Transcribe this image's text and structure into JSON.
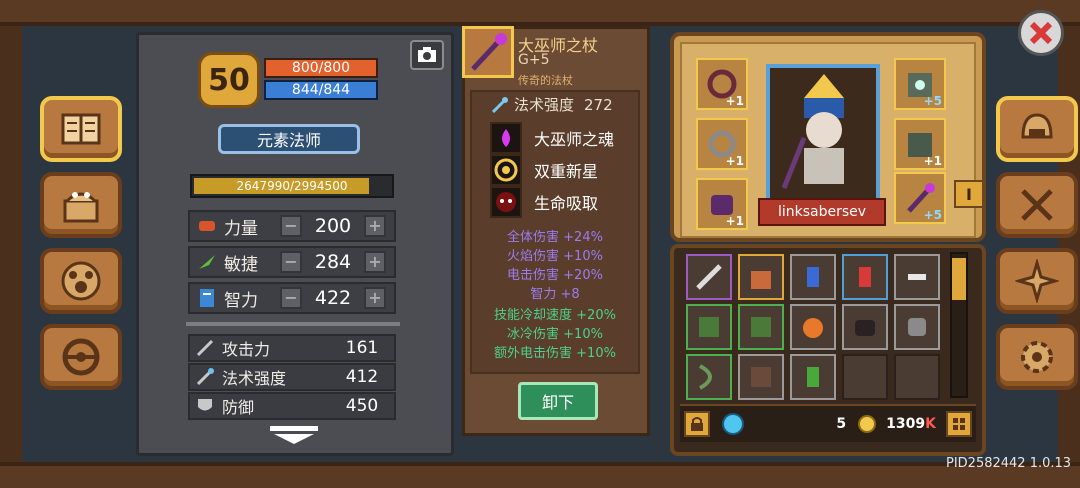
{
  "character": {
    "level": "50",
    "hp": "800/800",
    "mp": "844/844",
    "class_name": "元素法师",
    "xp_text": "2647990/2994500",
    "xp_fraction": 0.884,
    "attributes": [
      {
        "label": "力量",
        "value": "200",
        "color": "#d8542c"
      },
      {
        "label": "敏捷",
        "value": "284",
        "color": "#5fbf3a"
      },
      {
        "label": "智力",
        "value": "422",
        "color": "#3b88d6"
      }
    ],
    "stats": [
      {
        "label": "攻击力",
        "value": "161"
      },
      {
        "label": "法术强度",
        "value": "412"
      },
      {
        "label": "防御",
        "value": "450"
      }
    ]
  },
  "item": {
    "name": "大巫师之杖",
    "grade": "G+5",
    "type": "传奇的法杖",
    "magic_label": "法术强度",
    "magic_value": "272",
    "perks": [
      {
        "label": "大巫师之魂",
        "icon": "purple-flame-icon"
      },
      {
        "label": "双重新星",
        "icon": "target-icon"
      },
      {
        "label": "生命吸取",
        "icon": "skull-icon"
      }
    ],
    "bonuses": [
      {
        "text": "全体伤害 +24%",
        "color": "#9b7cf0"
      },
      {
        "text": "火焰伤害 +10%",
        "color": "#9b7cf0"
      },
      {
        "text": "电击伤害 +20%",
        "color": "#9b7cf0"
      },
      {
        "text": "智力 +8",
        "color": "#9b7cf0"
      },
      {
        "text": "技能冷却速度 +20%",
        "color": "#4fd08a"
      },
      {
        "text": "冰冷伤害 +10%",
        "color": "#4fd08a"
      },
      {
        "text": "额外电击伤害 +10%",
        "color": "#4fd08a"
      }
    ],
    "unequip_label": "卸下"
  },
  "equipment": {
    "player_name": "linksabersev",
    "tag_label": "I",
    "slots": [
      {
        "name": "necklace-slot",
        "plus": "+1"
      },
      {
        "name": "ring-slot",
        "plus": "+1"
      },
      {
        "name": "gloves-slot",
        "plus": "+1"
      },
      {
        "name": "chest-slot",
        "plus": "+5"
      },
      {
        "name": "armor-slot",
        "plus": "+1"
      },
      {
        "name": "staff-slot",
        "plus": "+5"
      }
    ]
  },
  "inventory": {
    "gems": "5",
    "coins": "1309",
    "coins_suffix": "K"
  },
  "footer": {
    "pid": "PID2582442 1.0.13"
  },
  "colors": {
    "accent": "#f2c94c",
    "panel": "#4b4d52",
    "wood": "#b7793f"
  }
}
